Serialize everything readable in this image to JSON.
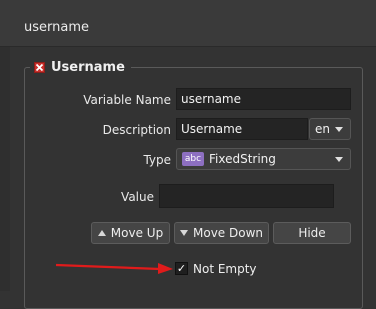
{
  "header": {
    "title": "username"
  },
  "group": {
    "title": "Username"
  },
  "form": {
    "variable_name": {
      "label": "Variable Name",
      "value": "username"
    },
    "description": {
      "label": "Description",
      "value": "Username",
      "lang": "en"
    },
    "type": {
      "label": "Type",
      "icon_text": "abc",
      "value": "FixedString"
    },
    "value": {
      "label": "Value",
      "value": ""
    }
  },
  "buttons": {
    "move_up": "Move Up",
    "move_down": "Move Down",
    "hide": "Hide"
  },
  "checkbox": {
    "label": "Not Empty",
    "checked": true,
    "mark": "✓"
  },
  "colors": {
    "accent_icon": "#8d6fc1",
    "delete_icon": "#c9302c",
    "annotation_arrow": "#e01b1b"
  }
}
